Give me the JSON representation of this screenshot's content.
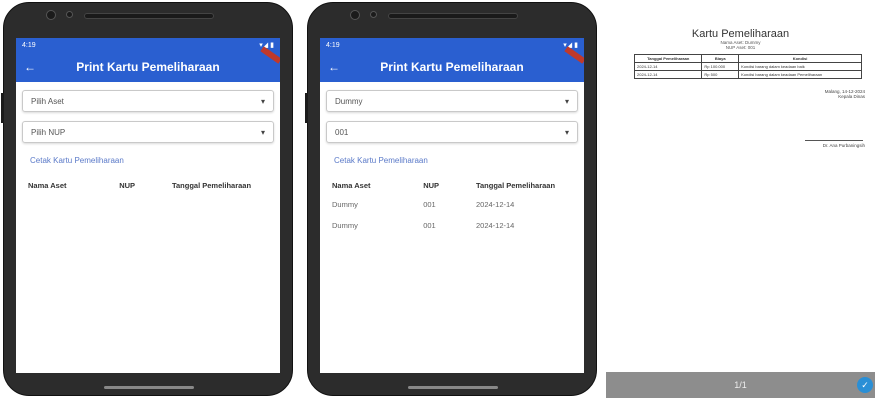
{
  "phone1": {
    "status_time": "4:19",
    "appbar_title": "Print Kartu Pemeliharaan",
    "select1": "Pilih Aset",
    "select2": "Pilih NUP",
    "link": "Cetak Kartu Pemeliharaan",
    "headers": [
      "Nama Aset",
      "NUP",
      "Tanggal Pemeliharaan"
    ]
  },
  "phone2": {
    "status_time": "4:19",
    "appbar_title": "Print Kartu Pemeliharaan",
    "select1": "Dummy",
    "select2": "001",
    "link": "Cetak Kartu Pemeliharaan",
    "headers": [
      "Nama Aset",
      "NUP",
      "Tanggal Pemeliharaan"
    ],
    "rows": [
      [
        "Dummy",
        "001",
        "2024-12-14"
      ],
      [
        "Dummy",
        "001",
        "2024-12-14"
      ]
    ]
  },
  "pdf": {
    "title": "Kartu Pemeliharaan",
    "sub1": "Nama Aset: Dummy",
    "sub2": "NUP Aset: 001",
    "table_headers": [
      "Tanggal Pemeliharaan",
      "Biaya",
      "Kondisi"
    ],
    "table_rows": [
      [
        "2024-12-14",
        "Rp 100.000",
        "Kondisi barang dalam keadaan baik"
      ],
      [
        "2024-12-14",
        "Rp 500",
        "Kondisi barang dalam keadaan Pemeliharaan"
      ]
    ],
    "sig_place": "Malang, 14-12-2024",
    "sig_role": "Kepala Dinas",
    "sig_name": "Dr. Ana Purbaningsih",
    "pager": "1/1"
  },
  "colors": {
    "appbar": "#2a5fd0",
    "link": "#5a79c8",
    "pager": "#8d8d8d"
  }
}
